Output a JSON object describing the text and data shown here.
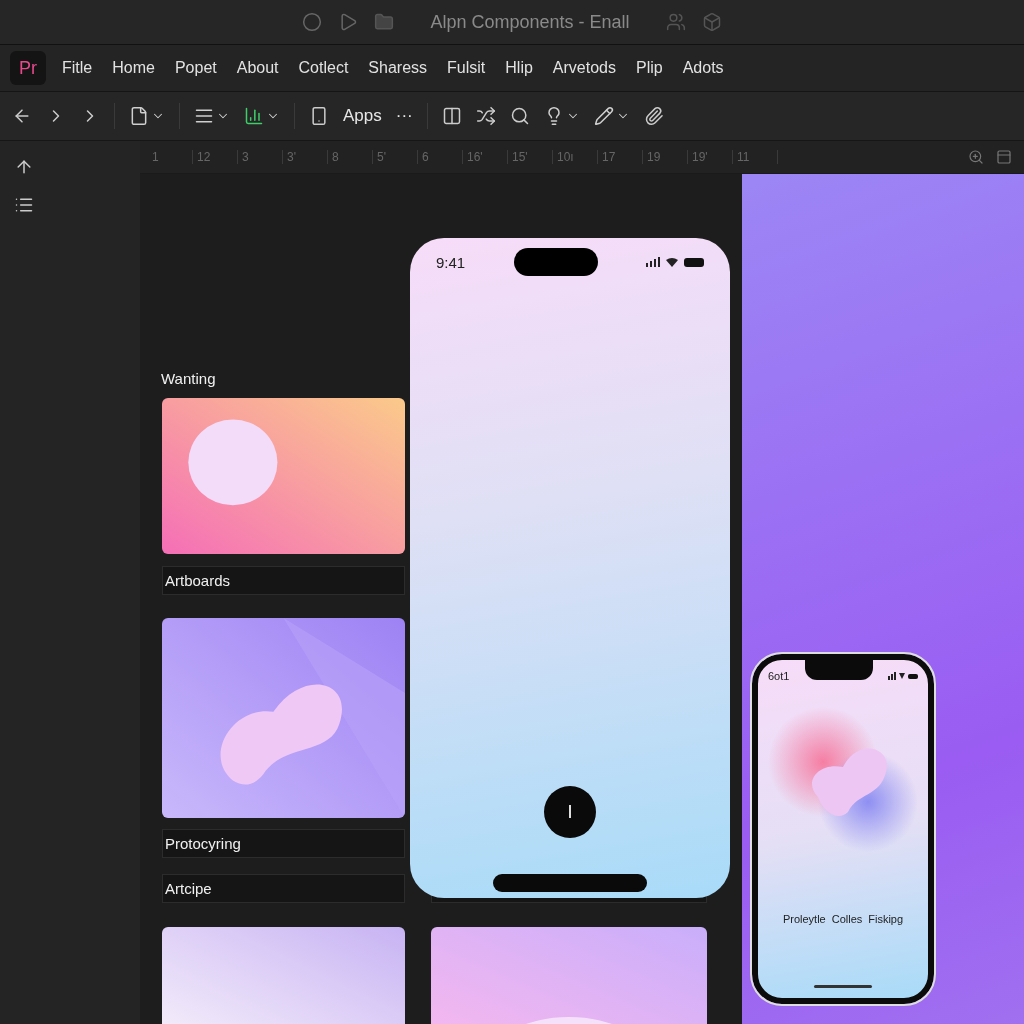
{
  "window": {
    "title": "Alpn Components - Enall"
  },
  "app_badge": "Pr",
  "menu": [
    "Fitle",
    "Home",
    "Popet",
    "About",
    "Cotlect",
    "Sharess",
    "Fulsit",
    "Hlip",
    "Arvetods",
    "Plip",
    "Adots"
  ],
  "toolbar": {
    "apps_label": "Apps",
    "more": "···"
  },
  "ruler": [
    "1",
    "12",
    "3",
    "3'",
    "8",
    "5'",
    "6",
    "16'",
    "15'",
    "10ı",
    "17",
    "19",
    "19'",
    "11"
  ],
  "canvas": {
    "sections": [
      {
        "kind": "heading",
        "label": "Wanting"
      },
      {
        "kind": "bar",
        "label": "Artboards"
      },
      {
        "kind": "bar",
        "label": "Protocyring"
      },
      {
        "kind": "bar",
        "label": "Artcipe"
      }
    ],
    "phone": {
      "time": "9:41",
      "button": "I"
    }
  },
  "preview_phone": {
    "time": "6ot1",
    "labels": [
      "Proleytle",
      "Colles",
      "Fiskipg"
    ]
  }
}
